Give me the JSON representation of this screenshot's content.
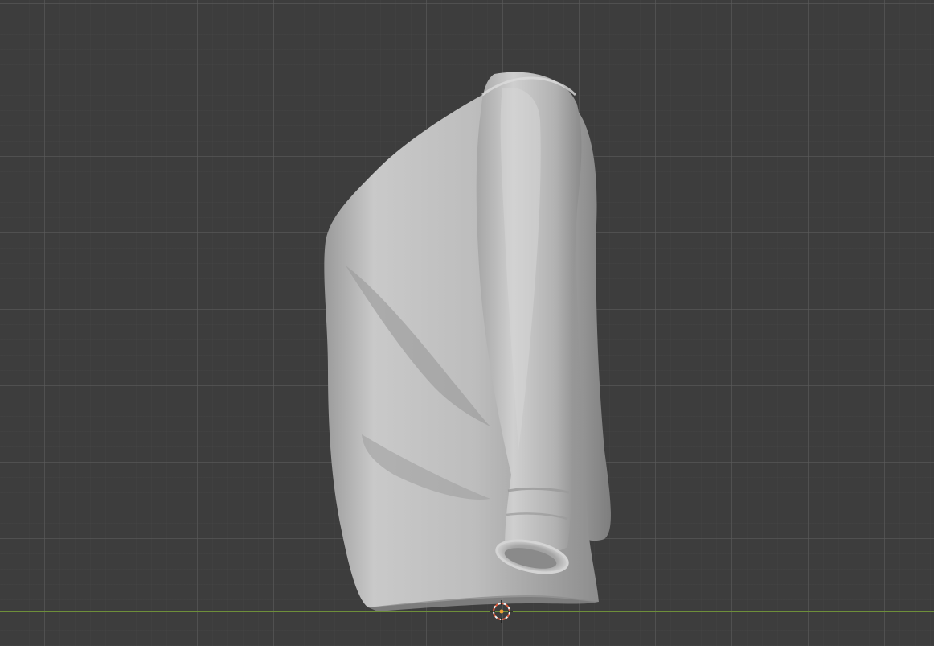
{
  "viewport": {
    "background_color": "#3d3d3d",
    "grid_major_color": "#5c5c5c",
    "grid_minor_color": "#464646",
    "z_axis_color": "#4a79b8",
    "x_axis_color": "#6e8f3a"
  },
  "object": {
    "type": "cloth-sweater-mesh",
    "shading": "solid",
    "base_color": "#b9b9b9"
  },
  "cursor_3d": {
    "icon": "3d-cursor-icon",
    "ring_color_a": "#e05a3a",
    "ring_color_b": "#f2f2f2"
  }
}
